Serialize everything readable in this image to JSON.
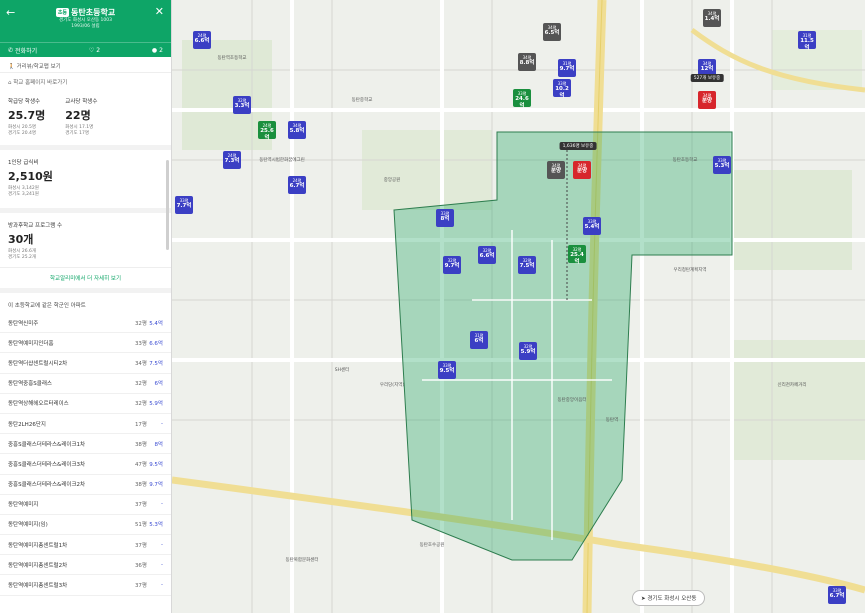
{
  "panel": {
    "school_type": "초등",
    "school_name": "동탄초등학교",
    "address": "경기도 화성시 오산동 1003",
    "founded": "1993/06 설립",
    "call_label": "전화하기",
    "heart_count": "2",
    "comment_count": "2",
    "distance_link": "거리뷰/학교맵 보기",
    "homepage_link": "학교 홈페이지 바로가기",
    "stat1": {
      "label": "학급당 학생수",
      "value": "25.7명",
      "line1": "화성시 20.5명",
      "line2": "경기도 20.4명"
    },
    "stat2": {
      "label": "교사당 학생수",
      "value": "22명",
      "line1": "화성시 17.1명",
      "line2": "경기도 17명"
    },
    "cost": {
      "label": "1인당 급식비",
      "value": "2,510원",
      "line1": "화성시 3,142원",
      "line2": "경기도 3,241원"
    },
    "program": {
      "label": "방과후학교 프로그램 수",
      "value": "30개",
      "line1": "화성시 26.6개",
      "line2": "경기도 25.2개"
    },
    "more_link": "학교알리미에서 더 자세히 보기",
    "apt_header": "이 초등학교에 같은 학군인 아파트",
    "apartments": [
      {
        "name": "동탄역신미주",
        "size": "32평",
        "price": "5.4억"
      },
      {
        "name": "동탄역예미지인더홈",
        "size": "33평",
        "price": "6.6억"
      },
      {
        "name": "동탄역더샵센트럴시티2차",
        "size": "34평",
        "price": "7.5억"
      },
      {
        "name": "동탄역중흥S클래스",
        "size": "32평",
        "price": "6억"
      },
      {
        "name": "동탄역상해헤오르터레이스",
        "size": "32평",
        "price": "5.9억"
      },
      {
        "name": "동탄2LH26단지",
        "size": "17평",
        "price": "-"
      },
      {
        "name": "중흥S클래스더테라스&레이크1차",
        "size": "38평",
        "price": "8억"
      },
      {
        "name": "중흥S클래스더테라스&레이크3차",
        "size": "47평",
        "price": "9.5억"
      },
      {
        "name": "중흥S클래스더테라스&레이크2차",
        "size": "38평",
        "price": "9.7억"
      },
      {
        "name": "동탄역예미지",
        "size": "37평",
        "price": "-"
      },
      {
        "name": "동탄역예미지(임)",
        "size": "51평",
        "price": "5.3억"
      },
      {
        "name": "동탄역예미지총센트럴1차",
        "size": "37평",
        "price": "-"
      },
      {
        "name": "동탄역예미지총센트럴2차",
        "size": "36평",
        "price": "-"
      },
      {
        "name": "동탄역예미지총센트럴3차",
        "size": "37평",
        "price": "-"
      }
    ]
  },
  "map": {
    "find_button": "경기도 화성시 오산동",
    "tooltip_top": "1,636명 보유중",
    "tooltip_right": "527개 보유중",
    "pins": [
      {
        "type": "blue",
        "area": "24평",
        "price": "6.6억"
      },
      {
        "type": "blue",
        "area": "32평",
        "price": "3.3억"
      },
      {
        "type": "blue",
        "area": "34평",
        "price": "5.8억"
      },
      {
        "type": "green",
        "area": "24평",
        "price": "25.6억"
      },
      {
        "type": "blue",
        "area": "24평",
        "price": "7.3억"
      },
      {
        "type": "blue",
        "area": "24평",
        "price": "6.7억"
      },
      {
        "type": "blue",
        "area": "33평",
        "price": "7.7억"
      },
      {
        "type": "gray",
        "area": "34평",
        "price": "6.5억"
      },
      {
        "type": "gray",
        "area": "34평",
        "price": "8.8억"
      },
      {
        "type": "blue",
        "area": "31평",
        "price": "9.7억"
      },
      {
        "type": "blue",
        "area": "33평",
        "price": "10.2억"
      },
      {
        "type": "green",
        "area": "33평",
        "price": "24.6억"
      },
      {
        "type": "gray",
        "area": "34평",
        "price": "분양"
      },
      {
        "type": "red",
        "area": "34평",
        "price": "분양"
      },
      {
        "type": "blue",
        "area": "33평",
        "price": "8억"
      },
      {
        "type": "blue",
        "area": "33평",
        "price": "5.4억"
      },
      {
        "type": "blue",
        "area": "32평",
        "price": "9.7억"
      },
      {
        "type": "blue",
        "area": "32평",
        "price": "6.6억"
      },
      {
        "type": "blue",
        "area": "32평",
        "price": "7.5억"
      },
      {
        "type": "green",
        "area": "32평",
        "price": "25.4억"
      },
      {
        "type": "blue",
        "area": "31평",
        "price": "6억"
      },
      {
        "type": "blue",
        "area": "32평",
        "price": "5.9억"
      },
      {
        "type": "blue",
        "area": "33평",
        "price": "9.5억"
      },
      {
        "type": "gray",
        "area": "34평",
        "price": "1.4억"
      },
      {
        "type": "blue",
        "area": "31평",
        "price": "11.5억"
      },
      {
        "type": "blue",
        "area": "34평",
        "price": "12억"
      },
      {
        "type": "red",
        "area": "34평",
        "price": "분양"
      },
      {
        "type": "blue",
        "area": "33평",
        "price": "5.3억"
      },
      {
        "type": "blue",
        "area": "33평",
        "price": "6.7억"
      }
    ],
    "labels": [
      "동탄역초등학교",
      "동탄중학교",
      "동탄역시범한화꿈에그린",
      "동탄초등학교",
      "우리청탄계획지역",
      "우리당(지역)",
      "신리천카페거리",
      "중앙공원",
      "SH센터",
      "동탄역",
      "동탄중앙이음터",
      "동탄호수공원",
      "동탄복합문화센터"
    ]
  }
}
